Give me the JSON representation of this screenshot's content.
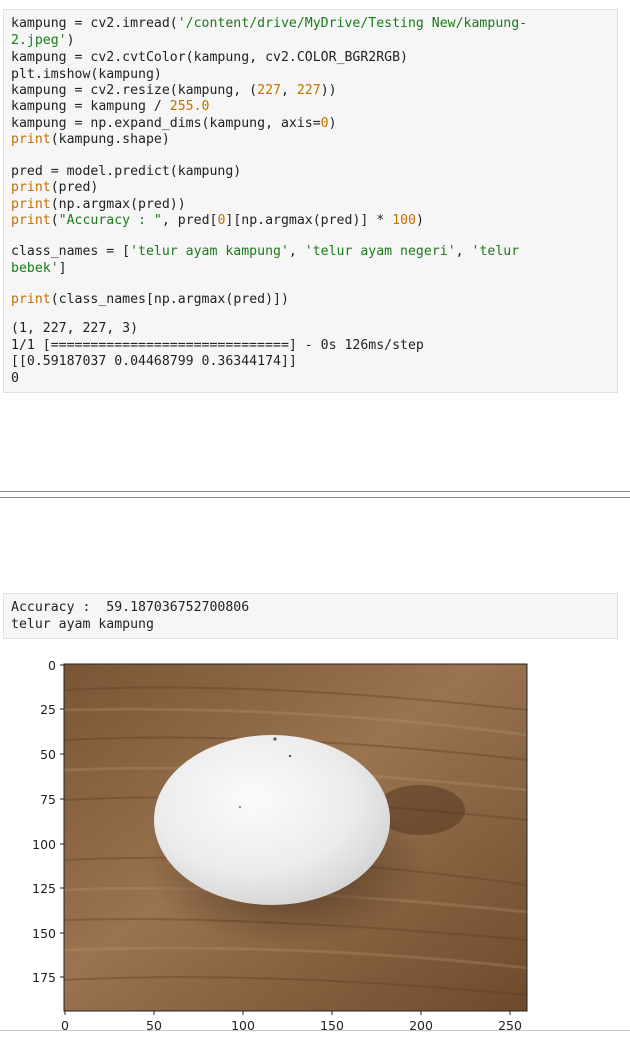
{
  "code_cell": {
    "lines": [
      "kampung = cv2.imread('/content/drive/MyDrive/Testing New/kampung-",
      "2.jpeg')",
      "kampung = cv2.cvtColor(kampung, cv2.COLOR_BGR2RGB)",
      "plt.imshow(kampung)",
      "kampung = cv2.resize(kampung, (227, 227))",
      "kampung = kampung / 255.0",
      "kampung = np.expand_dims(kampung, axis=0)",
      "print(kampung.shape)",
      "",
      "pred = model.predict(kampung)",
      "print(pred)",
      "print(np.argmax(pred))",
      "print(\"Accuracy : \", pred[0][np.argmax(pred)] * 100)",
      "",
      "class_names = ['telur ayam kampung', 'telur ayam negeri', 'telur",
      "bebek']",
      "",
      "print(class_names[np.argmax(pred)])"
    ],
    "output": [
      "(1, 227, 227, 3)",
      "1/1 [==============================] - 0s 126ms/step",
      "[[0.59187037 0.04468799 0.36344174]]",
      "0"
    ]
  },
  "output_cell": {
    "lines": [
      "Accuracy :  59.187036752700806",
      "telur ayam kampung"
    ]
  },
  "plot": {
    "image_alt": "white egg on wooden table",
    "y_ticks": [
      "0",
      "25",
      "50",
      "75",
      "100",
      "125",
      "150",
      "175"
    ],
    "x_ticks": [
      "0",
      "50",
      "100",
      "150",
      "200",
      "250"
    ],
    "colors": {
      "string": "#1a7a1a",
      "number": "#c07000",
      "builtin": "#c07000"
    }
  }
}
